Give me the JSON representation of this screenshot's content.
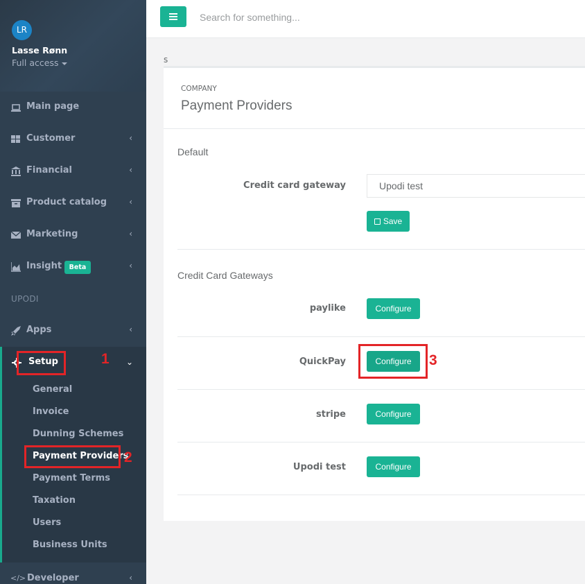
{
  "profile": {
    "initials": "LR",
    "name": "Lasse Rønn",
    "role": "Full access"
  },
  "nav": {
    "items": [
      {
        "label": "Main page",
        "icon": "laptop-icon"
      },
      {
        "label": "Customer",
        "icon": "grid-icon"
      },
      {
        "label": "Financial",
        "icon": "bank-icon"
      },
      {
        "label": "Product catalog",
        "icon": "archive-icon"
      },
      {
        "label": "Marketing",
        "icon": "envelope-icon"
      },
      {
        "label": "Insight",
        "icon": "area-chart-icon",
        "badge": "Beta"
      }
    ],
    "section": "UPODI",
    "apps": "Apps",
    "setup": "Setup",
    "developer": "Developer",
    "setup_items": [
      "General",
      "Invoice",
      "Dunning Schemes",
      "Payment Providers",
      "Payment Terms",
      "Taxation",
      "Users",
      "Business Units"
    ]
  },
  "topbar": {
    "search_placeholder": "Search for something..."
  },
  "breadcrumb": "s",
  "page": {
    "eyebrow": "COMPANY",
    "title": "Payment Providers"
  },
  "default_section": {
    "label": "Default",
    "gateway_label": "Credit card gateway",
    "gateway_value": "Upodi test",
    "save_label": "Save"
  },
  "gateways_section": {
    "label": "Credit Card Gateways",
    "configure_label": "Configure",
    "gateways": [
      "paylike",
      "QuickPay",
      "stripe",
      "Upodi test"
    ]
  },
  "annotations": [
    "1",
    "2",
    "3"
  ],
  "colors": {
    "sidebar": "#2f4050",
    "accent": "#1ab394",
    "annotation": "#e32427"
  }
}
